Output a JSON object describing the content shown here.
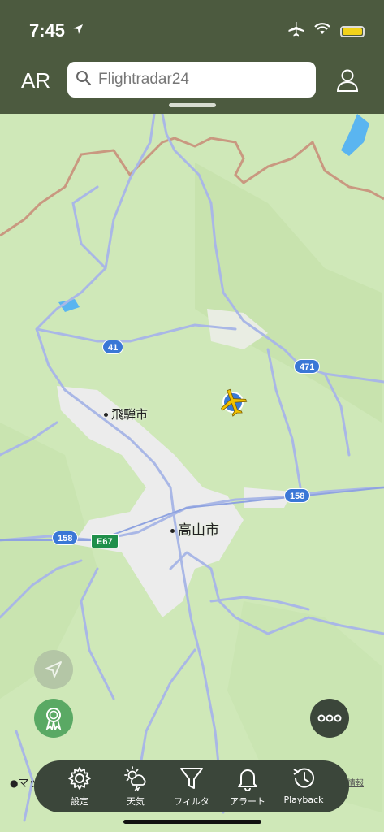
{
  "status_bar": {
    "time": "7:45"
  },
  "header": {
    "ar_label": "AR",
    "search_placeholder": "Flightradar24"
  },
  "map": {
    "places": [
      {
        "name": "飛騨市"
      },
      {
        "name": "高山市"
      }
    ],
    "route_shields": [
      {
        "label": "41",
        "color": "#3a77d6"
      },
      {
        "label": "471",
        "color": "#3a77d6"
      },
      {
        "label": "158",
        "color": "#3a77d6"
      },
      {
        "label": "158",
        "color": "#3a77d6"
      },
      {
        "label": "E67",
        "color": "#1f8f4a"
      }
    ],
    "attribution": "マップ",
    "legal_text": "に基づく情報"
  },
  "bottom_nav": {
    "items": [
      {
        "label": "設定",
        "icon": "gear-icon"
      },
      {
        "label": "天気",
        "icon": "weather-icon"
      },
      {
        "label": "フィルタ",
        "icon": "filter-icon"
      },
      {
        "label": "アラート",
        "icon": "bell-icon"
      },
      {
        "label": "Playback",
        "icon": "playback-icon"
      }
    ]
  },
  "colors": {
    "header_bg": "#4c5a3f",
    "map_land": "#cfe8b8",
    "road": "#a9b7e6",
    "urban": "#ececec",
    "nav_bg": "#3b463a",
    "aircraft": "#f2c200"
  }
}
